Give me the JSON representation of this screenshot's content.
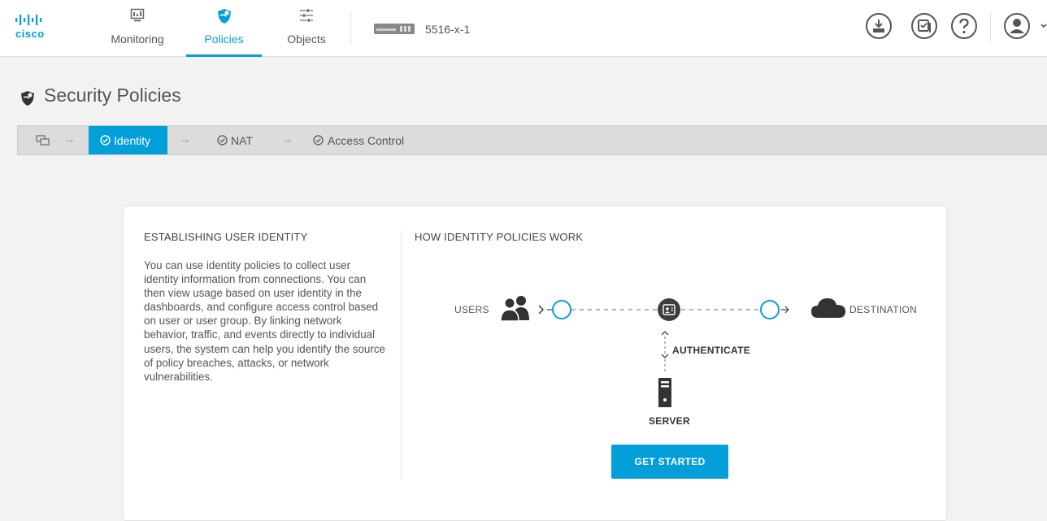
{
  "header": {
    "logo_text": "cisco",
    "nav": [
      {
        "label": "Monitoring",
        "icon": "monitor-icon"
      },
      {
        "label": "Policies",
        "icon": "shield-icon",
        "active": true
      },
      {
        "label": "Objects",
        "icon": "sliders-icon"
      }
    ],
    "device_name": "5516-x-1",
    "right_icons": [
      "deploy-icon",
      "task-list-icon",
      "help-icon",
      "user-avatar-icon"
    ]
  },
  "page": {
    "title": "Security Policies"
  },
  "pipeline": {
    "steps": [
      {
        "label": "Identity",
        "active": true
      },
      {
        "label": "NAT"
      },
      {
        "label": "Access Control"
      }
    ]
  },
  "card": {
    "left_heading": "ESTABLISHING USER IDENTITY",
    "body": "You can use identity policies to collect user identity information from connections. You can then view usage based on user identity in the dashboards, and configure access control based on user or user group. By linking network behavior, traffic, and events directly to individual users, the system can help you identify the source of policy breaches, attacks, or network vulnerabilities.",
    "right_heading": "HOW IDENTITY POLICIES WORK",
    "diagram": {
      "users_label": "USERS",
      "destination_label": "DESTINATION",
      "authenticate_label": "AUTHENTICATE",
      "server_label": "SERVER"
    },
    "button_label": "GET STARTED"
  },
  "colors": {
    "accent": "#049fd9",
    "pipeline_bg": "#dcdcdc",
    "page_bg": "#f2f2f2"
  }
}
